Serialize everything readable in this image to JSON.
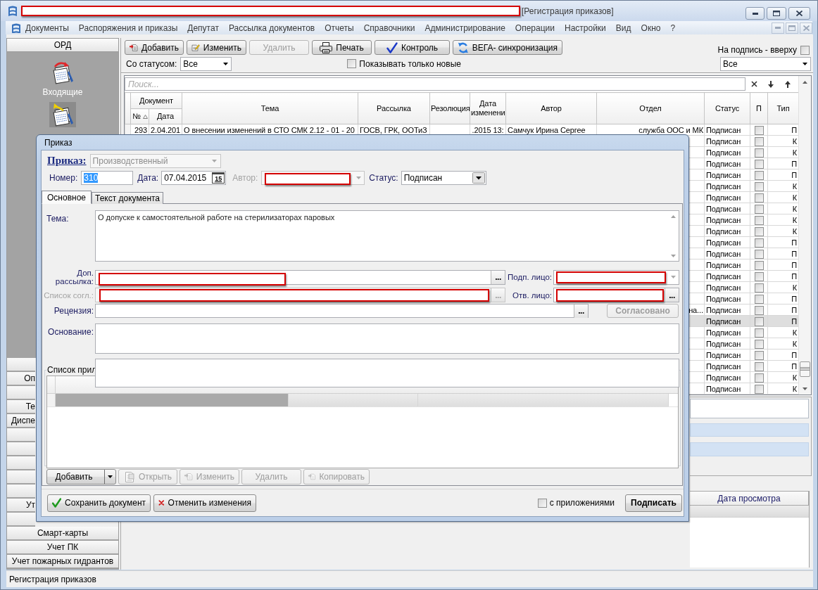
{
  "window": {
    "title": "[Регистрация приказов]"
  },
  "menu": [
    "Документы",
    "Распоряжения и приказы",
    "Депутат",
    "Рассылка документов",
    "Отчеты",
    "Справочники",
    "Администрирование",
    "Операции",
    "Настройки",
    "Вид",
    "Окно",
    "?"
  ],
  "sidebar": {
    "header": "ОРД",
    "launchers": [
      {
        "label": "Входящие",
        "selected": false
      },
      {
        "selected": true
      }
    ],
    "buttons": [
      {
        "covered": true
      },
      {
        "label": "Оп",
        "covered": true
      },
      {
        "covered": true
      },
      {
        "label": "Те",
        "covered": true
      },
      {
        "label": "Диспе",
        "covered": true
      },
      {
        "covered": true
      },
      {
        "covered": true
      },
      {
        "covered": true
      },
      {
        "covered": true
      },
      {
        "covered": true
      },
      {
        "label": "Ут",
        "covered": true
      },
      {
        "covered": true
      },
      {
        "label": "Смарт-карты",
        "covered": false
      },
      {
        "label": "Учет ПК",
        "covered": false
      },
      {
        "label": "Учет пожарных гидрантов",
        "covered": false
      }
    ]
  },
  "toolbar": {
    "buttons": [
      {
        "label": "Добавить",
        "kind": "add",
        "disabled": false
      },
      {
        "label": "Изменить",
        "kind": "edit",
        "disabled": false
      },
      {
        "label": "Удалить",
        "kind": "delete",
        "disabled": true
      },
      {
        "label": "Печать",
        "kind": "print",
        "disabled": false
      },
      {
        "label": "Контроль",
        "kind": "control",
        "disabled": false
      },
      {
        "label": "ВЕГА- синхронизация",
        "kind": "sync",
        "disabled": false
      }
    ],
    "sign_on_top": {
      "label": "На подпись - вверху",
      "checked": false
    }
  },
  "filters": {
    "status_label": "Со статусом:",
    "status_value": "Все",
    "only_new": {
      "label": "Показывать только новые",
      "checked": false
    },
    "view_value": "Все"
  },
  "search": {
    "placeholder": "Поиск..."
  },
  "table": {
    "group_header": "Документ",
    "columns": [
      "№",
      "Дата",
      "Тема",
      "Рассылка",
      "Резолюция",
      "Дата изменени",
      "Автор",
      "Отдел",
      "Статус",
      "П",
      "Тип"
    ],
    "rows": [
      {
        "number": "293",
        "date": "2.04.201",
        "subject": "О внесении изменений в СТО СМК 2.12 - 01 - 20",
        "mailing": "ГОСВ, ГРК, ООТиЗ",
        "modified": ".2015 13:",
        "author": "Самчук Ирина Сергее",
        "department": "служба ООС и МК",
        "status": "Подписан",
        "flag": false,
        "type": "П",
        "selected": false
      },
      {
        "status": "Подписан",
        "flag": false,
        "type": "К",
        "selected": false
      },
      {
        "status": "Подписан",
        "flag": false,
        "type": "К",
        "selected": false
      },
      {
        "status": "Подписан",
        "flag": false,
        "type": "П",
        "selected": false
      },
      {
        "status": "Подписан",
        "flag": false,
        "type": "П",
        "selected": false
      },
      {
        "status": "Подписан",
        "flag": false,
        "type": "К",
        "selected": false
      },
      {
        "status": "Подписан",
        "flag": false,
        "type": "К",
        "selected": false
      },
      {
        "status": "Подписан",
        "flag": false,
        "type": "К",
        "selected": false
      },
      {
        "status": "Подписан",
        "flag": false,
        "type": "К",
        "selected": false
      },
      {
        "status": "Подписан",
        "flag": false,
        "type": "К",
        "selected": false
      },
      {
        "status": "Подписан",
        "flag": false,
        "type": "П",
        "selected": false
      },
      {
        "status": "Подписан",
        "flag": false,
        "type": "П",
        "selected": false
      },
      {
        "status": "Подписан",
        "flag": false,
        "type": "П",
        "selected": false
      },
      {
        "status": "Подписан",
        "flag": false,
        "type": "П",
        "selected": false
      },
      {
        "status": "Подписан",
        "flag": false,
        "type": "К",
        "selected": false
      },
      {
        "status": "Подписан",
        "flag": false,
        "type": "П",
        "selected": false
      },
      {
        "department": "на...",
        "status": "Подписан",
        "flag": false,
        "type": "П",
        "selected": false
      },
      {
        "status": "Подписан",
        "flag": false,
        "type": "П",
        "selected": true
      },
      {
        "status": "Подписан",
        "flag": false,
        "type": "К",
        "selected": false
      },
      {
        "status": "Подписан",
        "flag": false,
        "type": "К",
        "selected": false
      },
      {
        "status": "Подписан",
        "flag": false,
        "type": "П",
        "selected": false
      },
      {
        "status": "Подписан",
        "flag": false,
        "type": "П",
        "selected": false
      },
      {
        "status": "Подписан",
        "flag": false,
        "type": "К",
        "selected": false
      },
      {
        "status": "Подписан",
        "flag": false,
        "type": "К",
        "selected": false
      }
    ]
  },
  "views_table": {
    "columns": [
      "Дата просмотра"
    ],
    "rows": [
      {
        "selected": true
      }
    ]
  },
  "dialog": {
    "title": "Приказ",
    "order_type": {
      "label": "Приказ:",
      "value": "Производственный",
      "disabled": true
    },
    "number": {
      "label": "Номер:",
      "value": "310",
      "highlighted": true
    },
    "date": {
      "label": "Дата:",
      "value": "07.04.2015",
      "calendar": "15"
    },
    "author": {
      "label": "Автор:",
      "disabled": true
    },
    "status": {
      "label": "Статус:",
      "value": "Подписан"
    },
    "tabs": [
      {
        "label": "Основное",
        "selected": true
      },
      {
        "label": "Текст документа",
        "selected": false
      }
    ],
    "subject": {
      "label": "Тема:",
      "value": "О допуске к самостоятельной работе на стерилизаторах паровых"
    },
    "extra_mailing": {
      "label": "Доп. рассылка:",
      "browse": "..."
    },
    "signer": {
      "label": "Подп. лицо:"
    },
    "approval_list": {
      "label": "Список согл.:",
      "browse": "...",
      "disabled": true
    },
    "responsible": {
      "label": "Отв. лицо:",
      "browse": "..."
    },
    "review": {
      "label": "Рецензия:",
      "browse": "...",
      "approve": {
        "label": "Согласовано",
        "disabled": true
      }
    },
    "basis": {
      "label": "Основание:"
    },
    "attachments": {
      "title": "Список прил",
      "rows": [
        {
          "selected": true
        }
      ],
      "buttons": [
        {
          "label": "Добавить",
          "kind": "split",
          "disabled": false
        },
        {
          "label": "Открыть",
          "kind": "open",
          "disabled": true
        },
        {
          "label": "Изменить",
          "kind": "edit",
          "disabled": true
        },
        {
          "label": "Удалить",
          "kind": "delete",
          "disabled": true
        },
        {
          "label": "Копировать",
          "kind": "copy",
          "disabled": true
        }
      ]
    },
    "footer": {
      "save": "Сохранить документ",
      "cancel": "Отменить изменения",
      "with_attachments": {
        "label": "с приложениями",
        "checked": false
      },
      "sign": "Подписать"
    }
  },
  "status_bar": {
    "text": "Регистрация приказов"
  }
}
